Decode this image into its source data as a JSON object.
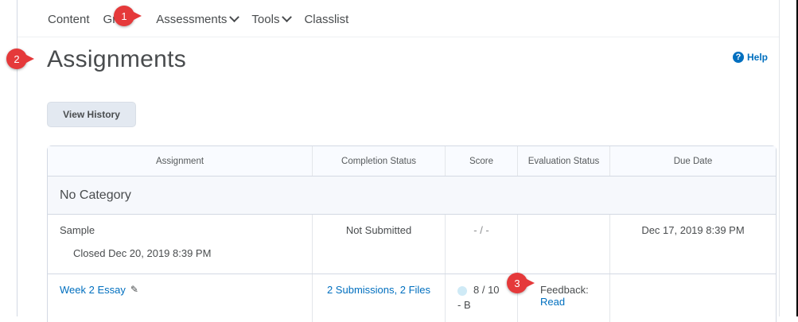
{
  "nav": {
    "items": [
      {
        "label": "Content",
        "dropdown": false
      },
      {
        "label": "Gr",
        "dropdown": false
      },
      {
        "label": "Assessments",
        "dropdown": true
      },
      {
        "label": "Tools",
        "dropdown": true
      },
      {
        "label": "Classlist",
        "dropdown": false
      }
    ]
  },
  "callouts": [
    "1",
    "2",
    "3"
  ],
  "page": {
    "title": "Assignments",
    "help_label": "Help",
    "help_icon": "question-icon",
    "view_history_label": "View History"
  },
  "table": {
    "headers": [
      "Assignment",
      "Completion Status",
      "Score",
      "Evaluation Status",
      "Due Date"
    ],
    "category": "No Category",
    "rows": [
      {
        "assignment": "Sample",
        "note": "Closed Dec 20, 2019 8:39 PM",
        "completion": "Not Submitted",
        "score": "- / -",
        "evaluation": "",
        "due": "Dec 17, 2019 8:39 PM"
      },
      {
        "assignment": "Week 2 Essay",
        "completion": "2 Submissions, 2 Files",
        "score": "8 / 10",
        "grade": "- B",
        "evaluation_prefix": "Feedback: ",
        "evaluation_link": "Read",
        "due": ""
      }
    ]
  },
  "colors": {
    "link": "#006fbf",
    "callout": "#e5393a",
    "button_bg": "#e3e9f1"
  }
}
